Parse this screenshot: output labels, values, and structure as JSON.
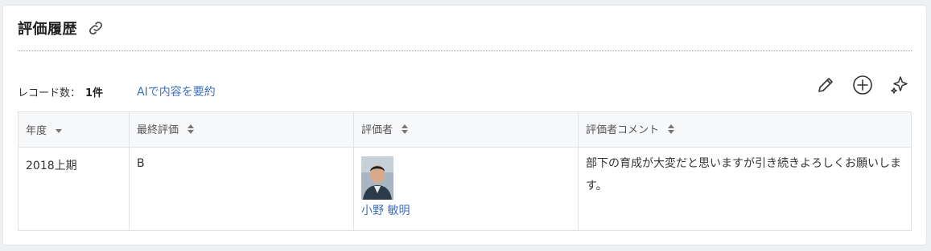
{
  "section": {
    "title": "評価履歴"
  },
  "meta": {
    "record_label": "レコード数：",
    "record_count": "1件",
    "ai_summary_link": "AIで内容を要約"
  },
  "toolbar": {
    "icons": [
      "edit-icon",
      "add-circle-icon",
      "sparkle-icon"
    ]
  },
  "table": {
    "headers": [
      "年度",
      "最終評価",
      "評価者",
      "評価者コメント"
    ],
    "rows": [
      {
        "year": "2018上期",
        "final_rating": "B",
        "evaluator": "小野 敏明",
        "comment": "部下の育成が大変だと思いますが引き続きよろしくお願いします。"
      }
    ]
  },
  "colors": {
    "link": "#3b6fc2",
    "border": "#dfe1e5",
    "header_bg": "#f7f8fa"
  }
}
